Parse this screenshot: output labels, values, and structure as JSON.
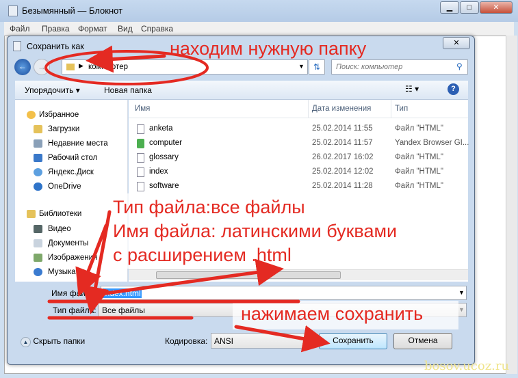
{
  "notepad": {
    "title": "Безымянный — Блокнот",
    "menu": [
      "Файл",
      "Правка",
      "Формат",
      "Вид",
      "Справка"
    ]
  },
  "dialog": {
    "title": "Сохранить как",
    "address": "компьютер",
    "search_placeholder": "Поиск: компьютер",
    "toolbar": {
      "organize": "Упорядочить",
      "new_folder": "Новая папка"
    },
    "sidebar": [
      {
        "label": "Избранное",
        "header": true
      },
      {
        "label": "Загрузки"
      },
      {
        "label": "Недавние места"
      },
      {
        "label": "Рабочий стол"
      },
      {
        "label": "Яндекс.Диск"
      },
      {
        "label": "OneDrive"
      },
      {
        "label": "Библиотеки",
        "header": true
      },
      {
        "label": "Видео"
      },
      {
        "label": "Документы"
      },
      {
        "label": "Изображения"
      },
      {
        "label": "Музыка"
      }
    ],
    "columns": [
      "Имя",
      "Дата изменения",
      "Тип"
    ],
    "files": [
      {
        "name": "anketa",
        "date": "25.02.2014 11:55",
        "type": "Файл \"HTML\""
      },
      {
        "name": "computer",
        "date": "25.02.2014 11:57",
        "type": "Yandex Browser GI..."
      },
      {
        "name": "glossary",
        "date": "26.02.2017 16:02",
        "type": "Файл \"HTML\""
      },
      {
        "name": "index",
        "date": "25.02.2014 12:02",
        "type": "Файл \"HTML\""
      },
      {
        "name": "software",
        "date": "25.02.2014 11:28",
        "type": "Файл \"HTML\""
      }
    ],
    "filename_label": "Имя файла:",
    "filename_value": "index.html",
    "filetype_label": "Тип файла:",
    "filetype_value": "Все файлы",
    "hide_folders": "Скрыть папки",
    "encoding_label": "Кодировка:",
    "encoding_value": "ANSI",
    "save": "Сохранить",
    "cancel": "Отмена"
  },
  "annotations": {
    "find_folder": "находим нужную папку",
    "line1": "Тип файла:все файлы",
    "line2": "Имя файла: латинскими буквами",
    "line3": "с расширением .html",
    "press_save": "нажимаем сохранить"
  },
  "watermark": "bosov.ucoz.ru"
}
